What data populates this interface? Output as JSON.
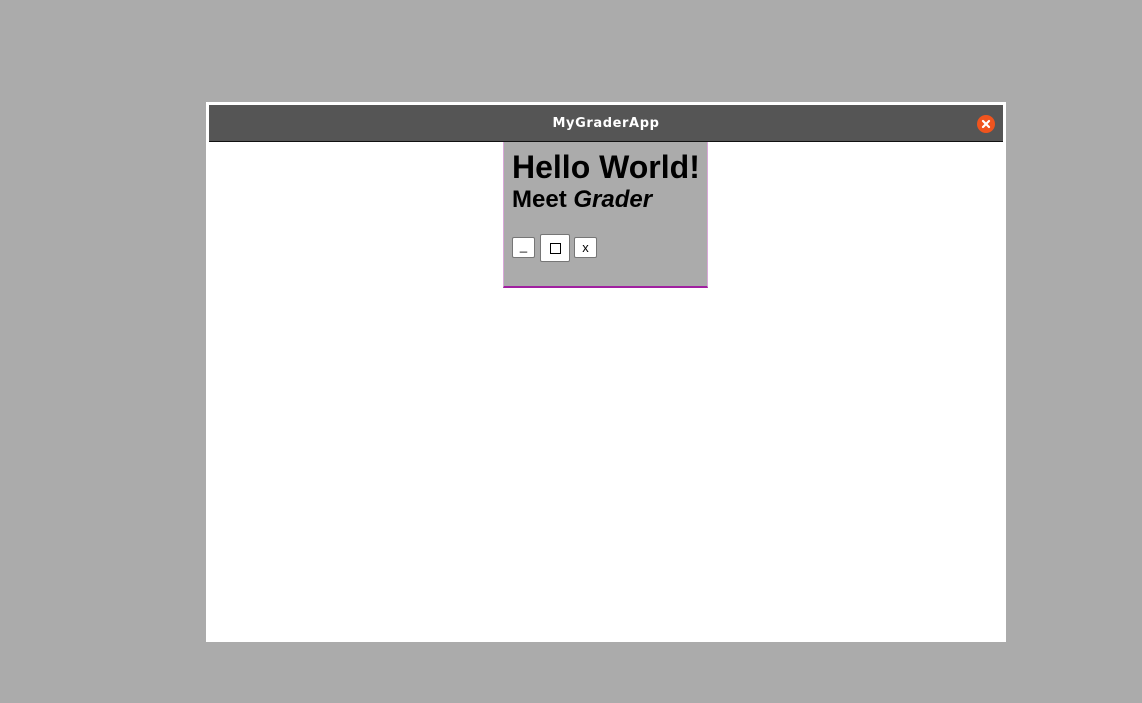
{
  "window": {
    "title": "MyGraderApp",
    "close_icon": "close-circle-icon",
    "close_color": "#f0541e"
  },
  "panel": {
    "heading": "Hello World!",
    "subheading_prefix": "Meet ",
    "subheading_emphasis": "Grader",
    "buttons": {
      "minimize_label": "_",
      "maximize_icon": "square-icon",
      "close_label": "x"
    }
  }
}
